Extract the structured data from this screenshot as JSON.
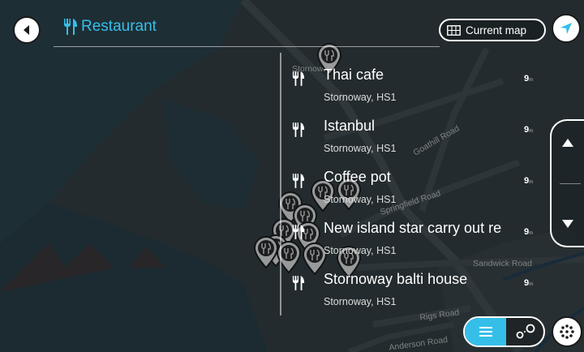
{
  "search": {
    "query": "Restaurant"
  },
  "header": {
    "current_map_label": "Current map"
  },
  "map_labels": {
    "town_fragment": "Stornoway",
    "roads": [
      "Goathill Road",
      "Springfield Road",
      "Sandwick Road",
      "Rigs Road",
      "Anderson Road"
    ]
  },
  "results": [
    {
      "name": "Thai cafe",
      "address": "Stornoway, HS1",
      "distance": "9",
      "unit": "m"
    },
    {
      "name": "Istanbul",
      "address": "Stornoway, HS1",
      "distance": "9",
      "unit": "m"
    },
    {
      "name": "Coffee pot",
      "address": "Stornoway, HS1",
      "distance": "9",
      "unit": "m"
    },
    {
      "name": "New island star carry out re",
      "address": "Stornoway, HS1",
      "distance": "9",
      "unit": "m"
    },
    {
      "name": "Stornoway balti house",
      "address": "Stornoway, HS1",
      "distance": "9",
      "unit": "m"
    }
  ],
  "icons": {
    "back": "arrow-left-icon",
    "search": "fork-knife-icon",
    "current_map": "map-icon",
    "locate": "navigation-arrow-icon",
    "scroll_up": "chevron-up-icon",
    "scroll_down": "chevron-down-icon",
    "list_view": "list-icon",
    "map_view": "route-points-icon",
    "menu": "menu-dots-icon",
    "result": "fork-knife-icon",
    "pin": "map-pin-icon"
  },
  "colors": {
    "accent": "#35bfe8",
    "text": "#ffffff",
    "map_water": "#2e4a55",
    "map_land": "#3a4448"
  }
}
